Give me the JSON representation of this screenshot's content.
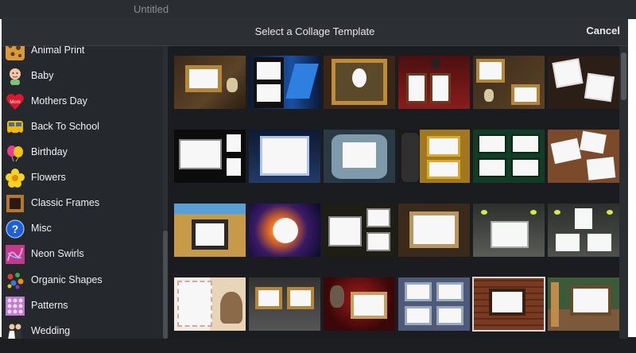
{
  "background": {
    "title": "Untitled"
  },
  "modal": {
    "title": "Select a Collage Template",
    "cancel_label": "Cancel"
  },
  "sidebar": {
    "items": [
      {
        "label": "Animal Print",
        "icon": "leopard-print-icon"
      },
      {
        "label": "Baby",
        "icon": "baby-icon"
      },
      {
        "label": "Mothers Day",
        "icon": "mom-heart-icon"
      },
      {
        "label": "Back To School",
        "icon": "school-bus-icon"
      },
      {
        "label": "Birthday",
        "icon": "balloons-icon"
      },
      {
        "label": "Flowers",
        "icon": "flower-icon"
      },
      {
        "label": "Classic Frames",
        "icon": "frame-icon"
      },
      {
        "label": "Misc",
        "icon": "question-mark-icon"
      },
      {
        "label": "Neon Swirls",
        "icon": "neon-swirl-icon"
      },
      {
        "label": "Organic Shapes",
        "icon": "organic-shapes-icon"
      },
      {
        "label": "Patterns",
        "icon": "pattern-icon"
      },
      {
        "label": "Wedding",
        "icon": "wedding-couple-icon"
      }
    ]
  },
  "templates": {
    "count": 24,
    "selected_index": 22
  },
  "colors": {
    "modal_bg": "#1f2226",
    "header_bg": "#2c2f34",
    "text": "#f0f0f0"
  }
}
